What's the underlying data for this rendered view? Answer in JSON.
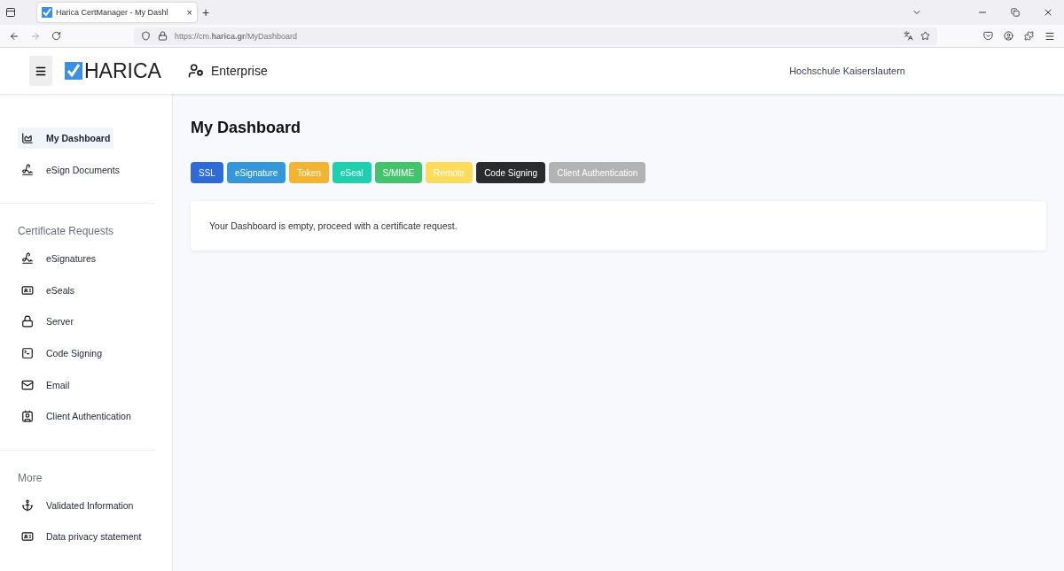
{
  "browser": {
    "tab_title": "Harica CertManager - My Dashl",
    "tab_close": "×",
    "new_tab": "+",
    "url": "https://cm.**harica.gr**/MyDashboard"
  },
  "header": {
    "logo": "HARICA",
    "product": "Enterprise",
    "organization": "Hochschule Kaiserslautern"
  },
  "sidebar": {
    "sections": [
      {
        "items": [
          {
            "label": "My Dashboard",
            "selected": true
          },
          {
            "label": "eSign Documents",
            "selected": false
          }
        ]
      },
      {
        "title": "Certificate Requests",
        "items": [
          {
            "label": "eSignatures",
            "selected": false
          },
          {
            "label": "eSeals",
            "selected": false
          },
          {
            "label": "Server",
            "selected": false
          },
          {
            "label": "Code Signing",
            "selected": false
          },
          {
            "label": "Email",
            "selected": false
          },
          {
            "label": "Client Authentication",
            "selected": false
          }
        ]
      },
      {
        "title": "More",
        "items": [
          {
            "label": "Validated Information",
            "selected": false
          },
          {
            "label": "Data privacy statement",
            "selected": false
          }
        ]
      }
    ]
  },
  "main": {
    "title": "My Dashboard",
    "filters": [
      {
        "label": "SSL",
        "color": "#2e6ad8"
      },
      {
        "label": "eSignature",
        "color": "#3497da"
      },
      {
        "label": "Token",
        "color": "#f2b531"
      },
      {
        "label": "eSeal",
        "color": "#1cd0b0"
      },
      {
        "label": "S/MIME",
        "color": "#43c46c"
      },
      {
        "label": "Remote",
        "color": "#fddc5c"
      },
      {
        "label": "Code Signing",
        "color": "#2a2b2d"
      },
      {
        "label": "Client Authentication",
        "color": "#b3b3b3"
      }
    ],
    "message": "Your Dashboard is empty, proceed with a certificate request."
  }
}
